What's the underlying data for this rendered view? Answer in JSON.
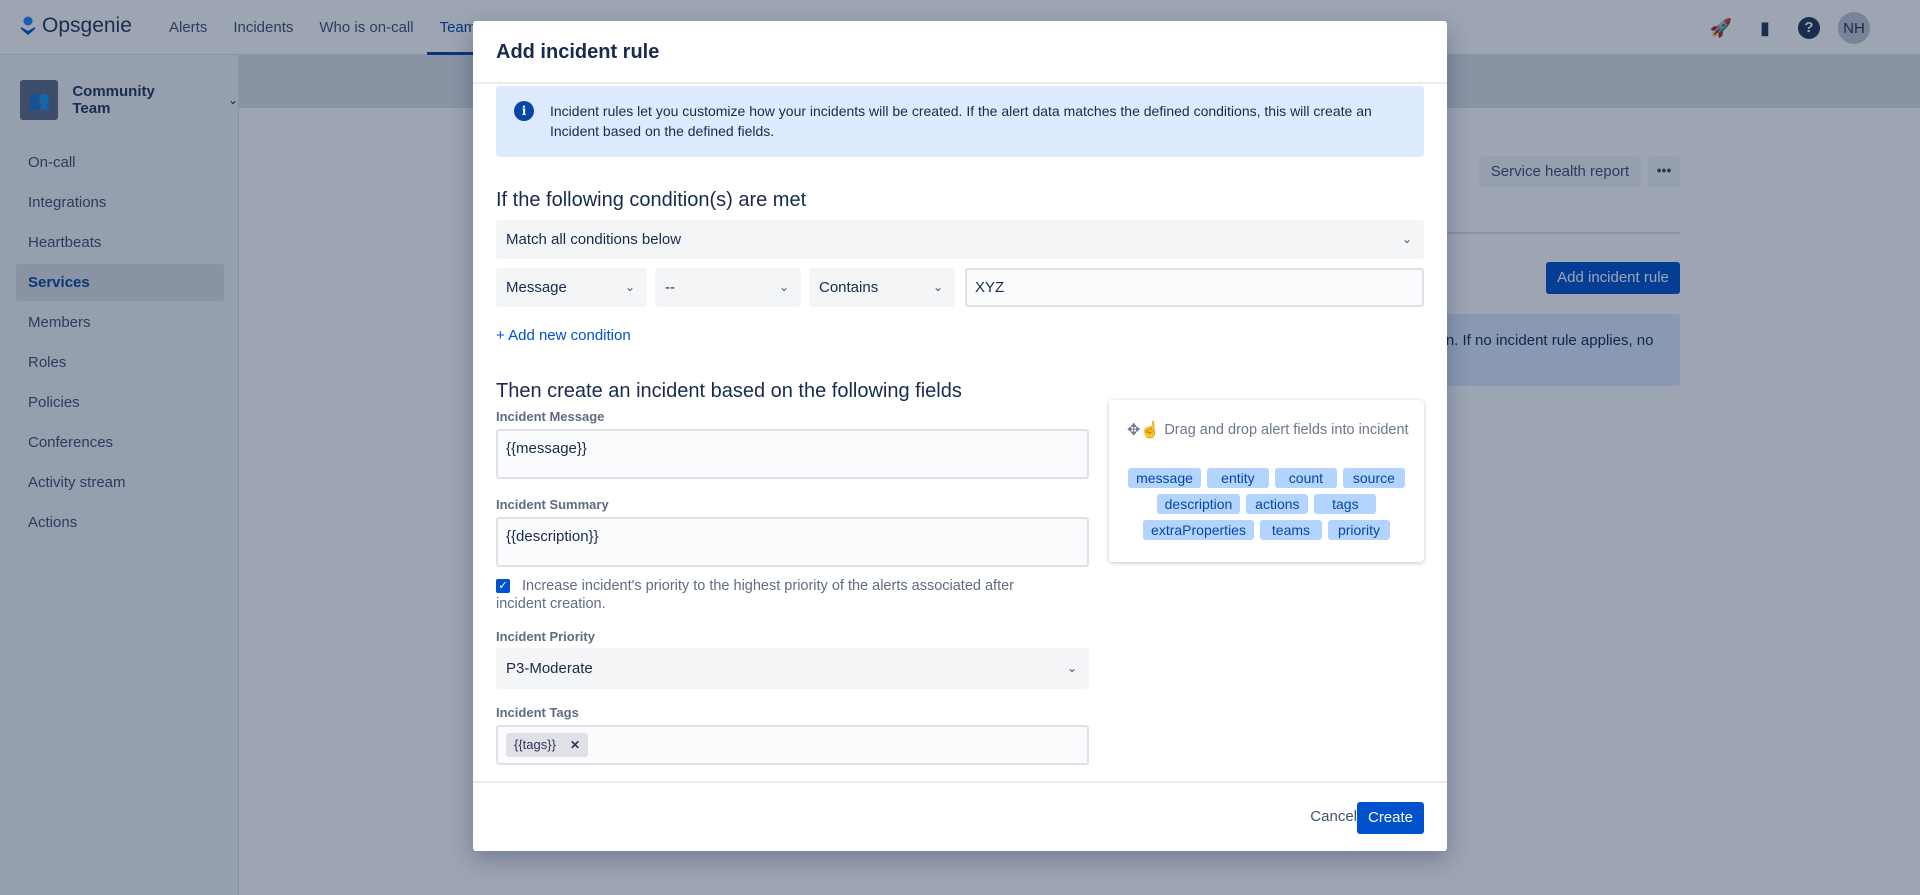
{
  "nav": {
    "brand": "Opsgenie",
    "links": [
      "Alerts",
      "Incidents",
      "Who is on-call",
      "Teams"
    ],
    "active": "Teams",
    "avatar": "NH",
    "icons": [
      "rocket-icon",
      "document-icon",
      "help-icon"
    ]
  },
  "sidebar": {
    "team": "Community Team",
    "items": [
      {
        "label": "On-call"
      },
      {
        "label": "Integrations"
      },
      {
        "label": "Heartbeats"
      },
      {
        "label": "Services"
      },
      {
        "label": "Members"
      },
      {
        "label": "Roles"
      },
      {
        "label": "Policies"
      },
      {
        "label": "Conferences"
      },
      {
        "label": "Activity stream"
      },
      {
        "label": "Actions"
      }
    ],
    "active": "Services"
  },
  "page": {
    "service_health_report": "Service health report",
    "more": "•••",
    "add_incident_rule": "Add incident rule",
    "info_fragment": "tion. If no incident rule applies, no"
  },
  "modal": {
    "title": "Add incident rule",
    "info": "Incident rules let you customize how your incidents will be created. If the alert data matches the defined conditions, this will create an Incident based on the defined fields.",
    "conditions_heading": "If the following condition(s) are met",
    "match": "Match all conditions below",
    "condition": {
      "field": "Message",
      "operator_not": "--",
      "operator": "Contains",
      "value": "XYZ"
    },
    "add_condition": "+ Add new condition",
    "fields_heading": "Then create an incident based on the following fields",
    "message_label": "Incident Message",
    "message_value": "{{message}}",
    "summary_label": "Incident Summary",
    "summary_value": "{{description}}",
    "increase_priority": "Increase incident's priority to the highest priority of the alerts associated after incident creation.",
    "increase_priority_checked": true,
    "priority_label": "Incident Priority",
    "priority_value": "P3-Moderate",
    "tags_label": "Incident Tags",
    "tags": [
      "{{tags}}"
    ],
    "drag_hint": "Drag and drop alert fields into incident",
    "alert_fields": [
      "message",
      "entity",
      "count",
      "source",
      "description",
      "actions",
      "tags",
      "extraProperties",
      "teams",
      "priority"
    ],
    "cancel": "Cancel",
    "create": "Create"
  }
}
